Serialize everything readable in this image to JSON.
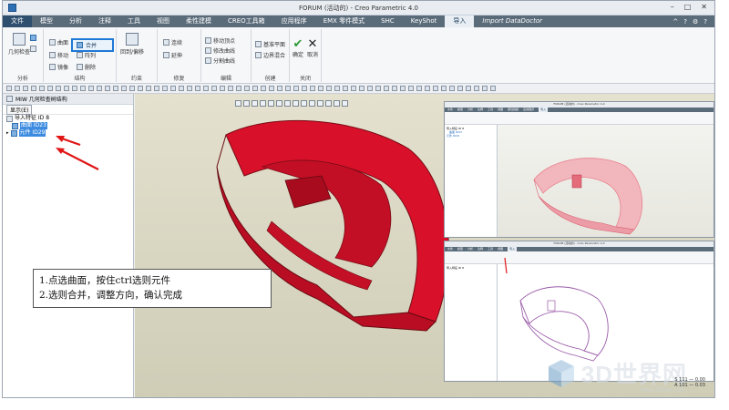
{
  "window": {
    "title": "FORUM (活动的) - Creo Parametric 4.0",
    "controls": [
      "–",
      "□",
      "✕"
    ]
  },
  "menu": {
    "items": [
      "文件",
      "模型",
      "分析",
      "注释",
      "工具",
      "视图",
      "柔性建模",
      "CREO工具箱",
      "应用程序",
      "EMX 零件模式",
      "SHC",
      "KeyShot",
      "导入",
      "Import DataDoctor"
    ],
    "active_index": 12,
    "right_icons": [
      "^",
      "?",
      "⚙",
      "?"
    ]
  },
  "ribbon": {
    "analysis_group": {
      "big_label": "几何检查",
      "label": "分析"
    },
    "structure_group": {
      "items": [
        "曲面",
        "合并",
        "移动",
        "阵列",
        "镜像",
        "删除"
      ],
      "label": "结构"
    },
    "merge_button": "合并",
    "constraint_group": {
      "items": [
        "回到/偏移"
      ],
      "label": "约束"
    },
    "repair_group": {
      "items": [
        "连续",
        "延伸"
      ],
      "label": "修复"
    },
    "edit_group": {
      "items": [
        "移动顶点",
        "修改曲线",
        "曲面",
        "分割曲线"
      ],
      "label": "编辑"
    },
    "create_group": {
      "items": [
        "基准平面",
        "边界混合"
      ],
      "label": "创建"
    },
    "close_group": {
      "ok": "确定",
      "cancel": "取消",
      "label": "关闭"
    },
    "group_labels": {
      "analysis": "分析",
      "structure": "结构",
      "constraint": "约束",
      "repair": "修复",
      "edit": "编辑",
      "create": "创建",
      "close": "关闭"
    }
  },
  "tree": {
    "header": "MIW 几何检查树结构",
    "filter": "显示(E)",
    "rows": [
      {
        "label": "导入特征 ID 8",
        "selected": false
      },
      {
        "label": "曲面 ID23",
        "selected": true
      },
      {
        "label": "元件 ID29",
        "selected": true
      }
    ]
  },
  "instruction": {
    "line1": "1.点选曲面，按住ctrl选则元件",
    "line2": "2.选则合并，调整方向，确认完成"
  },
  "inset1": {
    "title": "FORUM (活动的) - Creo Parametric 4.0",
    "menu": [
      "文件",
      "模型",
      "分析",
      "注释",
      "工具",
      "视图",
      "柔性建模",
      "应用程序",
      "导入"
    ],
    "tree_rows": [
      "导入特征 ID 8",
      "曲面 ID23",
      "元件 ID29"
    ]
  },
  "inset2": {
    "title": "FORUM (活动的) - Creo Parametric 4.0",
    "menu": [
      "文件",
      "模型",
      "分析",
      "注释",
      "工具",
      "视图",
      "导入"
    ],
    "tree_rows": [
      "导入特征 ID 8"
    ]
  },
  "watermark": {
    "text": "3D世界网",
    "sub": "www.3dsjw.com"
  },
  "status": {
    "line1": "S   111 — 0.00",
    "line2": "A   101 — 0.03"
  },
  "colors": {
    "model_red": "#d8102a",
    "model_dark": "#7a0c16",
    "highlight_blue": "#1e78d7",
    "arrow_red": "#e01616",
    "inset_model_pink": "#e8828e",
    "inset_model_purple": "#9a5aa8"
  }
}
